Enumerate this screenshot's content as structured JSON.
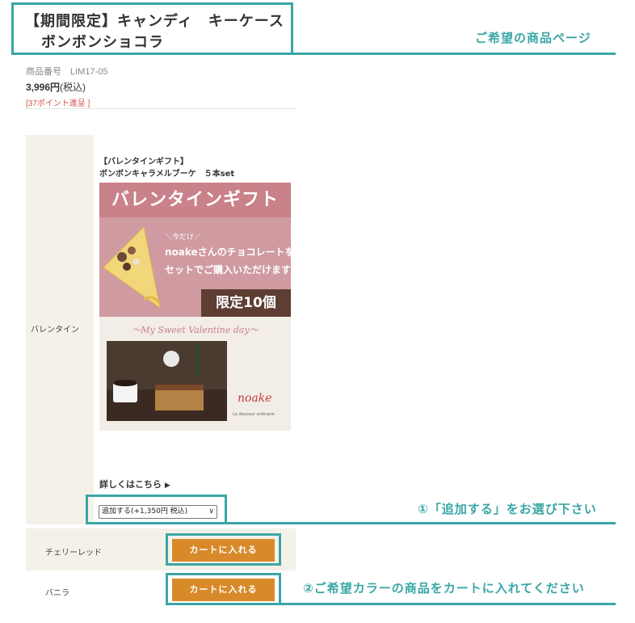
{
  "product": {
    "title_line1": "【期間限定】キャンディ　キーケース",
    "title_line2": "ボンボンショコラ",
    "code_label": "商品番号",
    "code": "LIM17-05",
    "price": "3,996円",
    "price_tax": "(税込)",
    "points": "[37ポイント進呈 ]"
  },
  "annotations": {
    "page_label": "ご希望の商品ページ",
    "step1": "①「追加する」をお選び下さい",
    "step2": "②ご希望カラーの商品をカートに入れてください",
    "color": "#3aa6a6"
  },
  "option": {
    "label": "バレンタイン",
    "gift_title_line1": "【バレンタインギフト】",
    "gift_title_line2": "ボンボンキャラメルブーケ　５本set",
    "banner": {
      "heading": "バレンタインギフト",
      "now": "＼今だけ／",
      "line1": "noakeさんのチョコレートを",
      "line2": "セットでご購入いただけます",
      "limit": "限定10個",
      "script": "〜My Sweet Valentine day〜",
      "brand": "noake",
      "brand_sub": "La douceur ordinaire"
    },
    "details_link": "詳しくはこちら",
    "details_arrow": "▶",
    "select_value": "追加する(+1,350円 税込)"
  },
  "variants": [
    {
      "name": "チェリーレッド",
      "button": "カートに入れる"
    },
    {
      "name": "バニラ",
      "button": "カートに入れる"
    }
  ]
}
